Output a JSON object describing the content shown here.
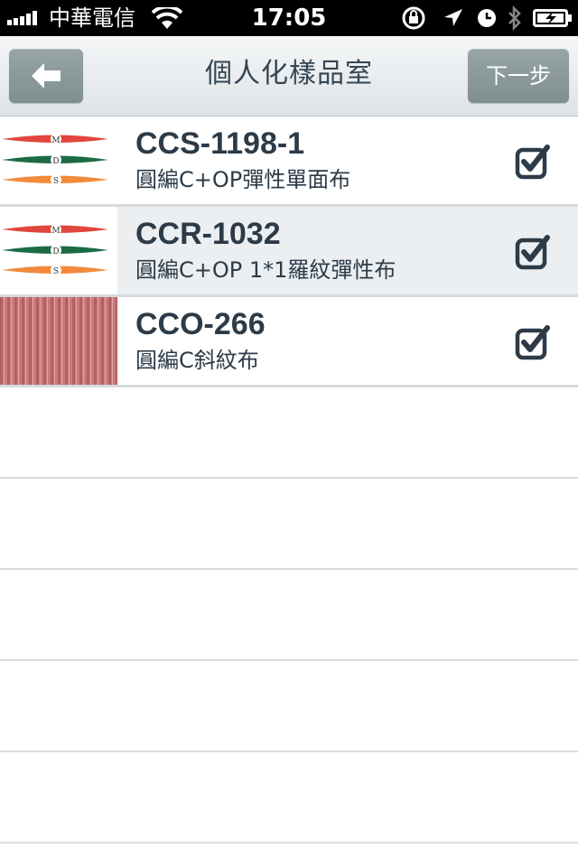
{
  "status_bar": {
    "carrier": "中華電信",
    "time": "17:05",
    "icons": [
      "signal-icon",
      "wifi-icon",
      "orientation-lock-icon",
      "location-icon",
      "alarm-icon",
      "bluetooth-icon",
      "battery-charging-icon"
    ]
  },
  "nav": {
    "title": "個人化樣品室",
    "back_icon": "arrow-left-icon",
    "next_label": "下一步"
  },
  "items": [
    {
      "code": "CCS-1198-1",
      "description": "圓編C+OP彈性單面布",
      "thumbnail": "mds-logo",
      "checked": true,
      "highlighted": false
    },
    {
      "code": "CCR-1032",
      "description": "圓編C+OP 1*1羅紋彈性布",
      "thumbnail": "mds-logo",
      "checked": true,
      "highlighted": true
    },
    {
      "code": "CCO-266",
      "description": "圓編C斜紋布",
      "thumbnail": "pink-twill-fabric",
      "checked": true,
      "highlighted": false
    }
  ],
  "logo_letters": [
    "M",
    "D",
    "S"
  ],
  "colors": {
    "nav_button": "#8a999b",
    "text_dark": "#2d3b48",
    "logo_red": "#e0463c",
    "logo_green": "#1c6b45",
    "logo_orange": "#f18a3a",
    "fabric_pink": "#c97a7e"
  }
}
